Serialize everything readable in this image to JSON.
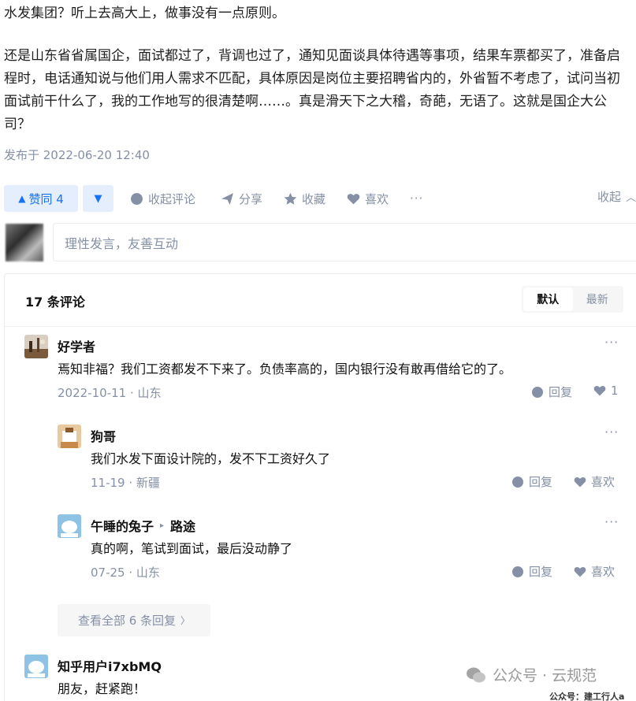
{
  "article": {
    "paragraph1": "水发集团？听上去高大上，做事没有一点原则。",
    "paragraph2": "还是山东省省属国企，面试都过了，背调也过了，通知见面谈具体待遇等事项，结果车票都买了，准备启程时，电话通知说与他们用人需求不匹配，具体原因是岗位主要招聘省内的，外省暂不考虑了，试问当初面试前干什么了，我的工作地写的很清楚啊……。真是滑天下之大稽，奇葩，无语了。这就是国企大公司？",
    "published": "发布于 2022-06-20 12:40"
  },
  "actions": {
    "upvote": "赞同 4",
    "upvote_glyph": "▲",
    "downvote_glyph": "▼",
    "collapse_comments": "收起评论",
    "share": "分享",
    "favorite": "收藏",
    "like": "喜欢",
    "more": "···",
    "collapse": "收起",
    "collapse_glyph": "︿"
  },
  "comment_input": {
    "placeholder": "理性发言，友善互动"
  },
  "comments": {
    "count": "17 条评论",
    "sort_default": "默认",
    "sort_latest": "最新",
    "items": [
      {
        "name": "好学者",
        "text": "焉知非福？我们工资都发不下来了。负债率高的，国内银行没有敢再借给它的了。",
        "meta": "2022-10-11 · 山东",
        "reply": "回复",
        "like": "1",
        "more": "···"
      },
      {
        "name": "狗哥",
        "text": "我们水发下面设计院的，发不下工资好久了",
        "meta": "11-19 · 新疆",
        "reply": "回复",
        "like": "喜欢",
        "more": "···"
      },
      {
        "name": "午睡的兔子",
        "reply_to": "路途",
        "reply_arrow": "▸",
        "text": "真的啊，笔试到面试，最后没动静了",
        "meta": "07-25 · 山东",
        "reply": "回复",
        "like": "喜欢",
        "more": "···"
      },
      {
        "name": "知乎用户i7xbMQ",
        "text": "朋友，赶紧跑！"
      }
    ],
    "view_all": "查看全部 6 条回复",
    "view_all_glyph": "〉"
  },
  "watermark": {
    "text": "公众号 · 云规范",
    "credit": "公众号：建工行人a"
  },
  "colors": {
    "accent": "#1772f6",
    "accent_bg": "#e5eefd",
    "muted": "#8590a6"
  }
}
